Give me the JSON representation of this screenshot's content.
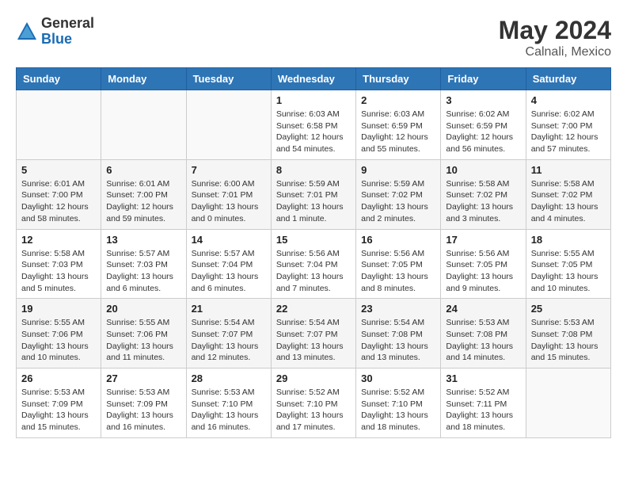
{
  "header": {
    "logo_general": "General",
    "logo_blue": "Blue",
    "month_year": "May 2024",
    "location": "Calnali, Mexico"
  },
  "days_of_week": [
    "Sunday",
    "Monday",
    "Tuesday",
    "Wednesday",
    "Thursday",
    "Friday",
    "Saturday"
  ],
  "weeks": [
    [
      {
        "day": "",
        "info": ""
      },
      {
        "day": "",
        "info": ""
      },
      {
        "day": "",
        "info": ""
      },
      {
        "day": "1",
        "info": "Sunrise: 6:03 AM\nSunset: 6:58 PM\nDaylight: 12 hours\nand 54 minutes."
      },
      {
        "day": "2",
        "info": "Sunrise: 6:03 AM\nSunset: 6:59 PM\nDaylight: 12 hours\nand 55 minutes."
      },
      {
        "day": "3",
        "info": "Sunrise: 6:02 AM\nSunset: 6:59 PM\nDaylight: 12 hours\nand 56 minutes."
      },
      {
        "day": "4",
        "info": "Sunrise: 6:02 AM\nSunset: 7:00 PM\nDaylight: 12 hours\nand 57 minutes."
      }
    ],
    [
      {
        "day": "5",
        "info": "Sunrise: 6:01 AM\nSunset: 7:00 PM\nDaylight: 12 hours\nand 58 minutes."
      },
      {
        "day": "6",
        "info": "Sunrise: 6:01 AM\nSunset: 7:00 PM\nDaylight: 12 hours\nand 59 minutes."
      },
      {
        "day": "7",
        "info": "Sunrise: 6:00 AM\nSunset: 7:01 PM\nDaylight: 13 hours\nand 0 minutes."
      },
      {
        "day": "8",
        "info": "Sunrise: 5:59 AM\nSunset: 7:01 PM\nDaylight: 13 hours\nand 1 minute."
      },
      {
        "day": "9",
        "info": "Sunrise: 5:59 AM\nSunset: 7:02 PM\nDaylight: 13 hours\nand 2 minutes."
      },
      {
        "day": "10",
        "info": "Sunrise: 5:58 AM\nSunset: 7:02 PM\nDaylight: 13 hours\nand 3 minutes."
      },
      {
        "day": "11",
        "info": "Sunrise: 5:58 AM\nSunset: 7:02 PM\nDaylight: 13 hours\nand 4 minutes."
      }
    ],
    [
      {
        "day": "12",
        "info": "Sunrise: 5:58 AM\nSunset: 7:03 PM\nDaylight: 13 hours\nand 5 minutes."
      },
      {
        "day": "13",
        "info": "Sunrise: 5:57 AM\nSunset: 7:03 PM\nDaylight: 13 hours\nand 6 minutes."
      },
      {
        "day": "14",
        "info": "Sunrise: 5:57 AM\nSunset: 7:04 PM\nDaylight: 13 hours\nand 6 minutes."
      },
      {
        "day": "15",
        "info": "Sunrise: 5:56 AM\nSunset: 7:04 PM\nDaylight: 13 hours\nand 7 minutes."
      },
      {
        "day": "16",
        "info": "Sunrise: 5:56 AM\nSunset: 7:05 PM\nDaylight: 13 hours\nand 8 minutes."
      },
      {
        "day": "17",
        "info": "Sunrise: 5:56 AM\nSunset: 7:05 PM\nDaylight: 13 hours\nand 9 minutes."
      },
      {
        "day": "18",
        "info": "Sunrise: 5:55 AM\nSunset: 7:05 PM\nDaylight: 13 hours\nand 10 minutes."
      }
    ],
    [
      {
        "day": "19",
        "info": "Sunrise: 5:55 AM\nSunset: 7:06 PM\nDaylight: 13 hours\nand 10 minutes."
      },
      {
        "day": "20",
        "info": "Sunrise: 5:55 AM\nSunset: 7:06 PM\nDaylight: 13 hours\nand 11 minutes."
      },
      {
        "day": "21",
        "info": "Sunrise: 5:54 AM\nSunset: 7:07 PM\nDaylight: 13 hours\nand 12 minutes."
      },
      {
        "day": "22",
        "info": "Sunrise: 5:54 AM\nSunset: 7:07 PM\nDaylight: 13 hours\nand 13 minutes."
      },
      {
        "day": "23",
        "info": "Sunrise: 5:54 AM\nSunset: 7:08 PM\nDaylight: 13 hours\nand 13 minutes."
      },
      {
        "day": "24",
        "info": "Sunrise: 5:53 AM\nSunset: 7:08 PM\nDaylight: 13 hours\nand 14 minutes."
      },
      {
        "day": "25",
        "info": "Sunrise: 5:53 AM\nSunset: 7:08 PM\nDaylight: 13 hours\nand 15 minutes."
      }
    ],
    [
      {
        "day": "26",
        "info": "Sunrise: 5:53 AM\nSunset: 7:09 PM\nDaylight: 13 hours\nand 15 minutes."
      },
      {
        "day": "27",
        "info": "Sunrise: 5:53 AM\nSunset: 7:09 PM\nDaylight: 13 hours\nand 16 minutes."
      },
      {
        "day": "28",
        "info": "Sunrise: 5:53 AM\nSunset: 7:10 PM\nDaylight: 13 hours\nand 16 minutes."
      },
      {
        "day": "29",
        "info": "Sunrise: 5:52 AM\nSunset: 7:10 PM\nDaylight: 13 hours\nand 17 minutes."
      },
      {
        "day": "30",
        "info": "Sunrise: 5:52 AM\nSunset: 7:10 PM\nDaylight: 13 hours\nand 18 minutes."
      },
      {
        "day": "31",
        "info": "Sunrise: 5:52 AM\nSunset: 7:11 PM\nDaylight: 13 hours\nand 18 minutes."
      },
      {
        "day": "",
        "info": ""
      }
    ]
  ]
}
